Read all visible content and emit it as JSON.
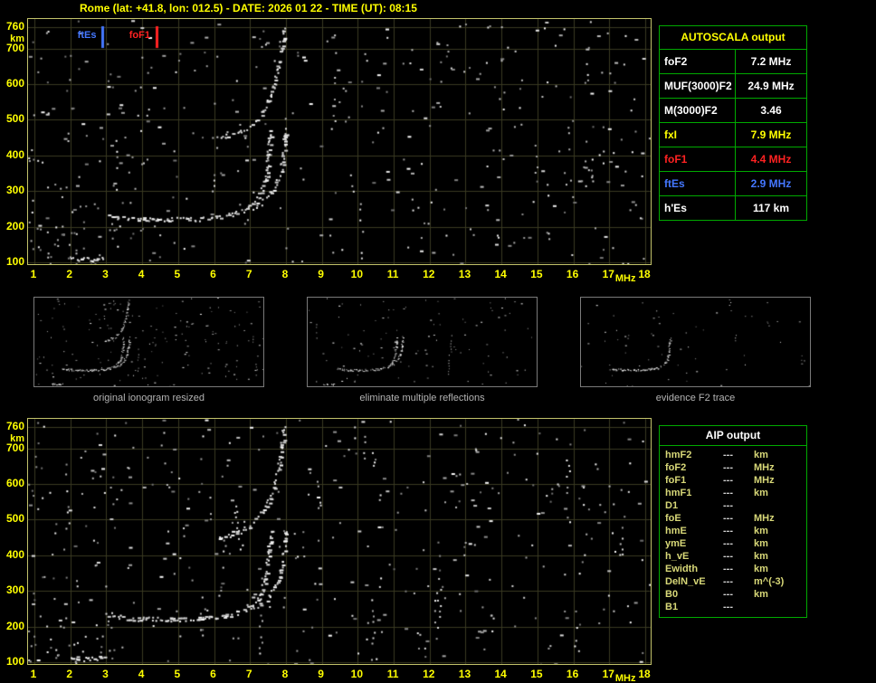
{
  "title": "Rome (lat: +41.8, lon: 012.5) - DATE: 2026 01 22 - TIME (UT): 08:15",
  "autoscala": {
    "header": "AUTOSCALA output",
    "rows": [
      {
        "label": "foF2",
        "value": "7.2",
        "unit": "MHz",
        "color": "#ffffff"
      },
      {
        "label": "MUF(3000)F2",
        "value": "24.9",
        "unit": "MHz",
        "color": "#ffffff"
      },
      {
        "label": "M(3000)F2",
        "value": "3.46",
        "unit": "",
        "color": "#ffffff"
      },
      {
        "label": "fxI",
        "value": "7.9",
        "unit": "MHz",
        "color": "#ffff00"
      },
      {
        "label": "foF1",
        "value": "4.4",
        "unit": "MHz",
        "color": "#ff2222"
      },
      {
        "label": "ftEs",
        "value": "2.9",
        "unit": "MHz",
        "color": "#4477ff"
      },
      {
        "label": "h'Es",
        "value": "117",
        "unit": "km",
        "color": "#ffffff"
      }
    ]
  },
  "aip": {
    "header": "AIP output",
    "rows": [
      {
        "name": "hmF2",
        "value": "---",
        "unit": "km"
      },
      {
        "name": "foF2",
        "value": "---",
        "unit": "MHz"
      },
      {
        "name": "foF1",
        "value": "---",
        "unit": "MHz"
      },
      {
        "name": "hmF1",
        "value": "---",
        "unit": "km"
      },
      {
        "name": "D1",
        "value": "---",
        "unit": ""
      },
      {
        "name": "foE",
        "value": "---",
        "unit": "MHz"
      },
      {
        "name": "hmE",
        "value": "---",
        "unit": "km"
      },
      {
        "name": "ymE",
        "value": "---",
        "unit": "km"
      },
      {
        "name": "h_vE",
        "value": "---",
        "unit": "km"
      },
      {
        "name": "Ewidth",
        "value": "---",
        "unit": "km"
      },
      {
        "name": "DelN_vE",
        "value": "---",
        "unit": "m^(-3)"
      },
      {
        "name": "B0",
        "value": "---",
        "unit": "km"
      },
      {
        "name": "B1",
        "value": "---",
        "unit": ""
      }
    ]
  },
  "thumbnails": [
    {
      "caption": "original ionogram resized",
      "traces": [
        "Es-layer-trace",
        "F-trace-ordinary",
        "F-trace-extraordinary",
        "second-hop-reflection"
      ]
    },
    {
      "caption": "eliminate multiple reflections",
      "traces": [
        "Es-layer-trace",
        "F-trace-ordinary",
        "F-trace-extraordinary"
      ]
    },
    {
      "caption": "evidence F2 trace",
      "traces": [
        "F-trace-ordinary"
      ]
    }
  ],
  "chart_data": {
    "type": "scatter",
    "title": "Ionogram - Rome 2026 01 22 08:15 UT",
    "xlabel": "MHz",
    "ylabel": "km",
    "xlim": [
      1,
      18
    ],
    "ylim": [
      100,
      760
    ],
    "grid": true,
    "x_ticks": [
      1,
      2,
      3,
      4,
      5,
      6,
      7,
      8,
      9,
      10,
      11,
      12,
      13,
      14,
      15,
      16,
      17,
      18
    ],
    "y_ticks": [
      760,
      700,
      600,
      500,
      400,
      300,
      200,
      100
    ],
    "series": [
      {
        "name": "Es-layer-trace",
        "points": [
          [
            2.0,
            116
          ],
          [
            2.2,
            111
          ],
          [
            2.45,
            110
          ],
          [
            2.7,
            112
          ],
          [
            2.9,
            116
          ]
        ]
      },
      {
        "name": "F-trace-ordinary",
        "points": [
          [
            3.0,
            234
          ],
          [
            3.3,
            228
          ],
          [
            3.6,
            225
          ],
          [
            4.0,
            223
          ],
          [
            4.4,
            222
          ],
          [
            4.8,
            222
          ],
          [
            5.2,
            222
          ],
          [
            5.6,
            224
          ],
          [
            6.0,
            227
          ],
          [
            6.3,
            232
          ],
          [
            6.6,
            239
          ],
          [
            6.85,
            249
          ],
          [
            7.05,
            262
          ],
          [
            7.2,
            279
          ],
          [
            7.32,
            302
          ],
          [
            7.4,
            330
          ],
          [
            7.46,
            365
          ],
          [
            7.5,
            405
          ],
          [
            7.53,
            445
          ],
          [
            7.55,
            470
          ]
        ]
      },
      {
        "name": "F-trace-extraordinary",
        "points": [
          [
            7.05,
            253
          ],
          [
            7.3,
            267
          ],
          [
            7.5,
            285
          ],
          [
            7.65,
            307
          ],
          [
            7.78,
            336
          ],
          [
            7.87,
            372
          ],
          [
            7.93,
            412
          ],
          [
            7.97,
            450
          ],
          [
            8.0,
            475
          ]
        ]
      },
      {
        "name": "second-hop-reflection",
        "points": [
          [
            6.1,
            452
          ],
          [
            6.4,
            459
          ],
          [
            6.7,
            469
          ],
          [
            6.95,
            482
          ],
          [
            7.15,
            499
          ],
          [
            7.35,
            523
          ],
          [
            7.5,
            553
          ],
          [
            7.65,
            595
          ],
          [
            7.77,
            645
          ],
          [
            7.86,
            700
          ],
          [
            7.93,
            760
          ]
        ]
      }
    ],
    "markers": [
      {
        "name": "ftEs",
        "freq": 2.9,
        "color": "#4477ff"
      },
      {
        "name": "foF1",
        "freq": 4.4,
        "color": "#ff2222"
      }
    ]
  }
}
